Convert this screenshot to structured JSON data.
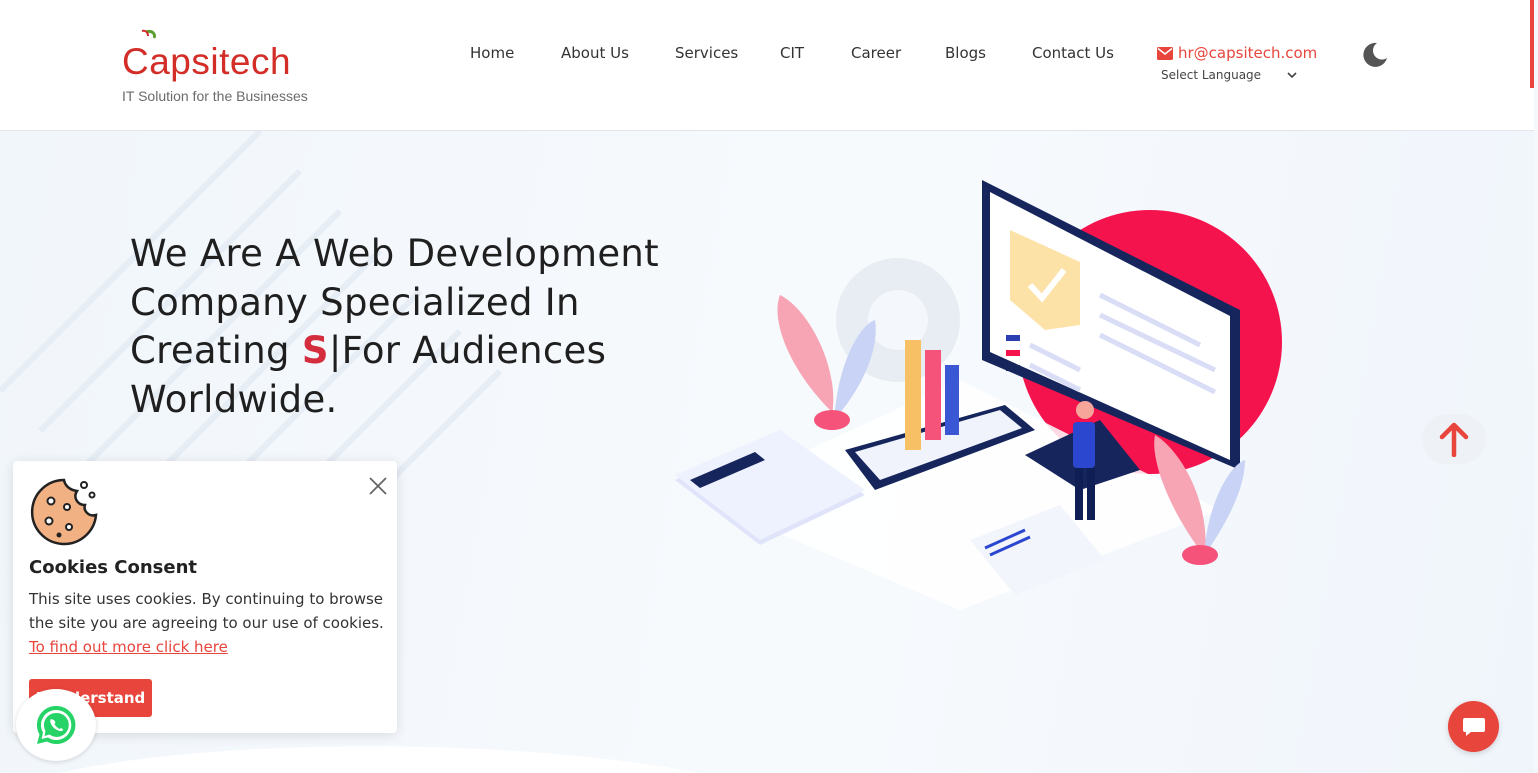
{
  "brand": {
    "name": "Capsitech",
    "tagline": "IT Solution for the Businesses",
    "accent_color": "#e8453c"
  },
  "nav": {
    "items": [
      {
        "label": "Home"
      },
      {
        "label": "About Us"
      },
      {
        "label": "Services"
      },
      {
        "label": "CIT"
      },
      {
        "label": "Career"
      },
      {
        "label": "Blogs"
      },
      {
        "label": "Contact Us"
      }
    ],
    "email": "hr@capsitech.com",
    "language_select": "Select Language",
    "theme_toggle_icon": "moon-icon"
  },
  "hero": {
    "title_prefix": "We Are A Web Development Company Specialized In Creating ",
    "title_typed": "S",
    "title_cursor": "|",
    "title_suffix": "For Audiences Worldwide."
  },
  "cookie_consent": {
    "title": "Cookies Consent",
    "text": "This site uses cookies. By continuing to browse the site you are agreeing to our use of cookies. ",
    "link_text": "To find out more click here",
    "button_label": "I Understand"
  },
  "floating": {
    "scroll_top_icon": "arrow-up-icon",
    "chat_icon": "chat-icon",
    "whatsapp_icon": "whatsapp-icon"
  }
}
